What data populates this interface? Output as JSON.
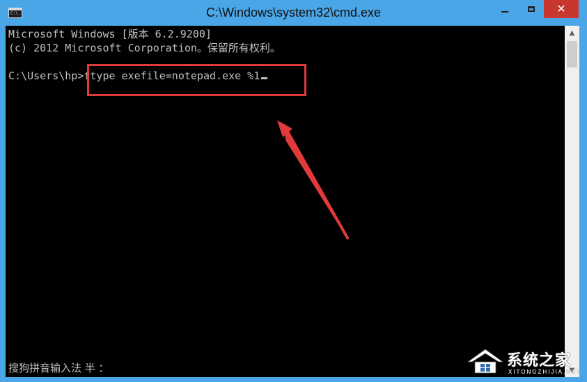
{
  "window": {
    "title": "C:\\Windows\\system32\\cmd.exe",
    "icon_label": "C:\\."
  },
  "caption_buttons": {
    "minimize_icon": "minimize-icon",
    "maximize_icon": "maximize-icon",
    "close_icon": "close-icon",
    "close_glyph": "✕"
  },
  "console": {
    "lines": [
      "Microsoft Windows [版本 6.2.9200]",
      "(c) 2012 Microsoft Corporation。保留所有权利。"
    ],
    "prompt": "C:\\Users\\hp>",
    "command": "ftype exefile=notepad.exe %1",
    "ime_status": "搜狗拼音输入法 半 ："
  },
  "annotation": {
    "color": "#e13a3a"
  },
  "scrollbar": {
    "up_glyph": "▲",
    "down_glyph": "▼"
  },
  "watermark": {
    "brand": "系统之家",
    "sub": "XITONGZHIJIA.NET"
  },
  "colors": {
    "titlebar": "#4aa6e6",
    "console_bg": "#000000",
    "console_text": "#c0c0c0",
    "close_button": "#c7372e"
  }
}
